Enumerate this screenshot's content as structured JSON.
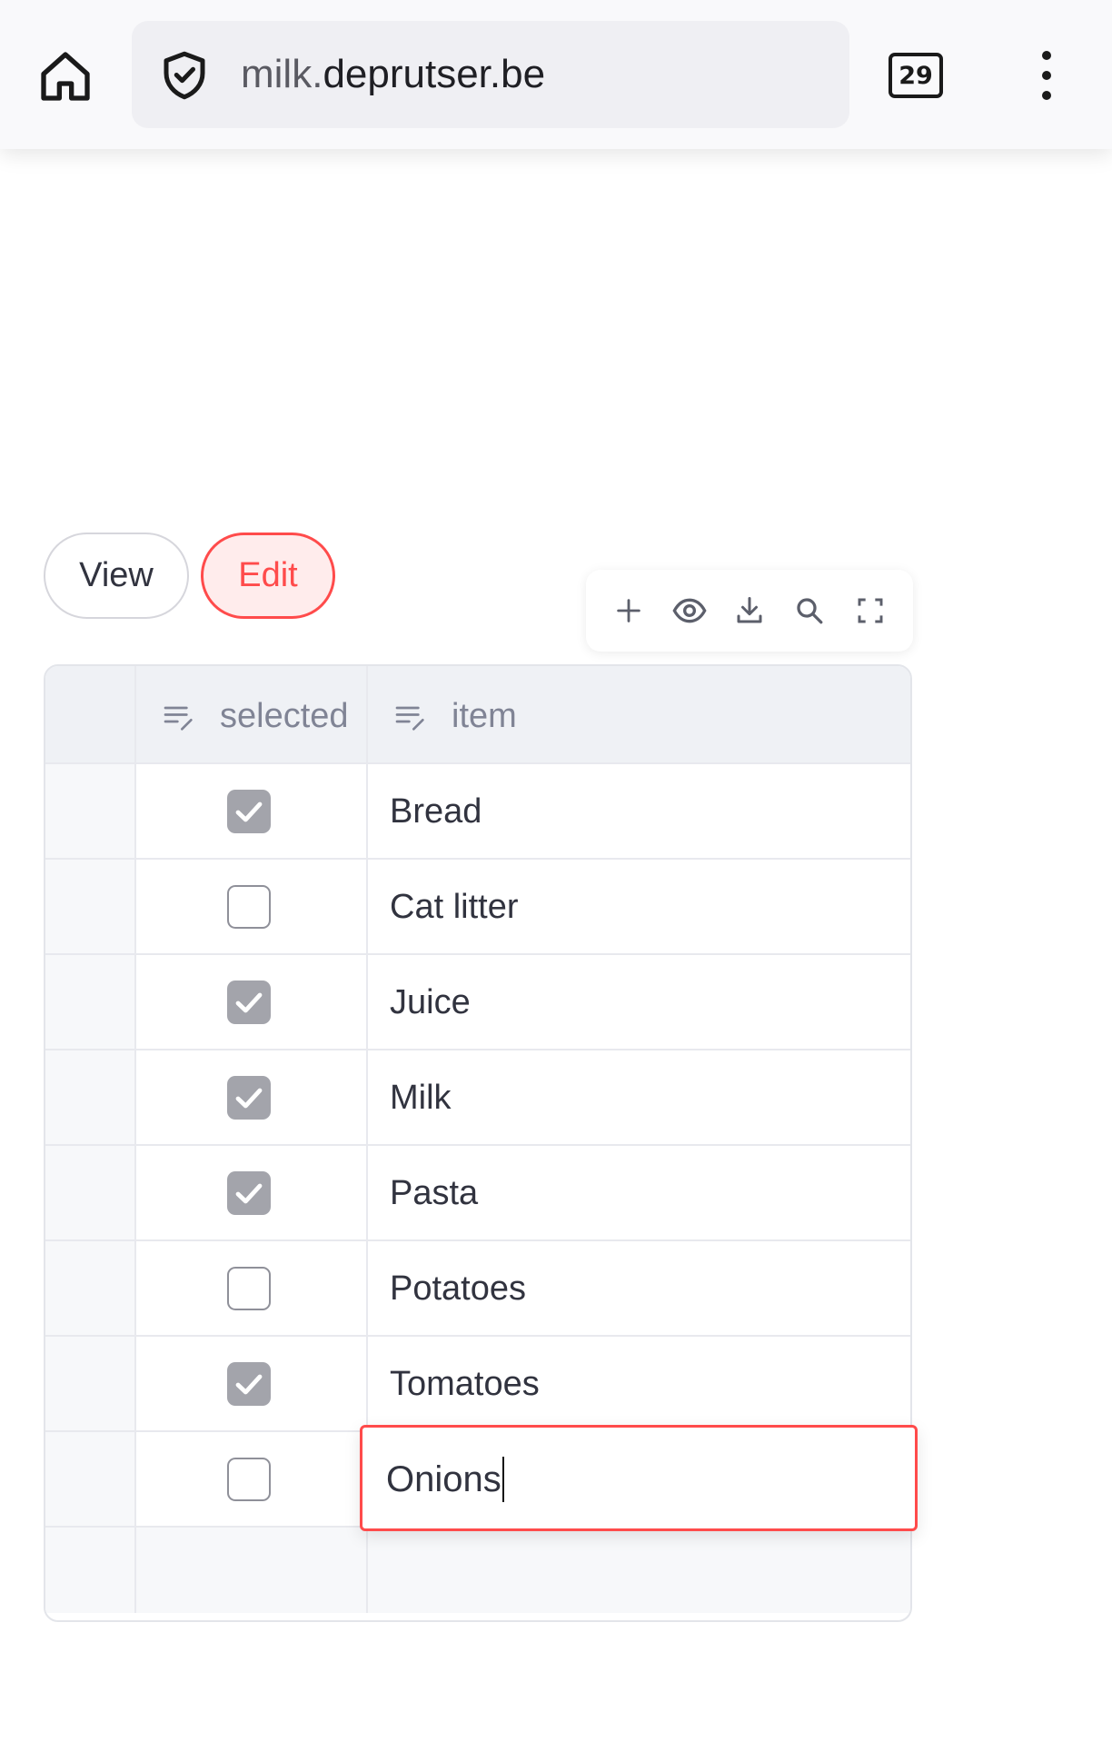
{
  "browser": {
    "url_prefix": "milk.",
    "url_domain": "deprutser.be",
    "tab_count": "29"
  },
  "modes": {
    "view_label": "View",
    "edit_label": "Edit",
    "active": "Edit"
  },
  "toolbar": {
    "icons": [
      "add-row-icon",
      "visibility-icon",
      "download-icon",
      "search-icon",
      "fullscreen-icon"
    ]
  },
  "table": {
    "columns": [
      "selected",
      "item"
    ],
    "rows": [
      {
        "selected": true,
        "item": "Bread"
      },
      {
        "selected": false,
        "item": "Cat litter"
      },
      {
        "selected": true,
        "item": "Juice"
      },
      {
        "selected": true,
        "item": "Milk"
      },
      {
        "selected": true,
        "item": "Pasta"
      },
      {
        "selected": false,
        "item": "Potatoes"
      },
      {
        "selected": true,
        "item": "Tomatoes"
      },
      {
        "selected": false,
        "item": ""
      }
    ],
    "editing_value": "Onions"
  },
  "colors": {
    "accent": "#ff4b4b",
    "header_bg": "#eff1f5",
    "checked_bg": "#a3a4ab"
  }
}
